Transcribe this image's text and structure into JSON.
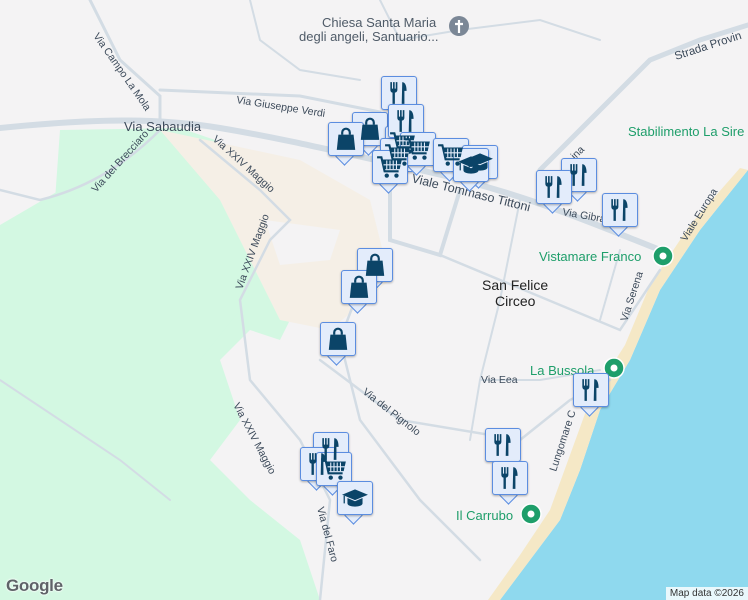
{
  "map": {
    "place_label": [
      "San Felice",
      "Circeo"
    ],
    "church_label": [
      "Chiesa Santa Maria",
      "degli angeli, Santuario..."
    ],
    "streets": {
      "sabaudia": "Via Sabaudia",
      "sabaudia2": "Via Sabaudia",
      "verdi": "Via Giuseppe Verdi",
      "campo": "Via Campo La Mola",
      "brecciaro": "Via del Brecciaro",
      "xxiv1": "Via XXIV Maggio",
      "xxiv2": "Via XXIV Maggio",
      "xxiv3": "Via XXIV Maggio",
      "tittoni": "Viale Tommaso Tittoni",
      "gibral": "Via Gibral",
      "strada": "Strada Provin",
      "europa": "Viale Europa",
      "serena": "Via Serena",
      "eea": "Via Eea",
      "pignolo": "Via del Pignolo",
      "lungomare": "Lungomare C",
      "faro": "Via del Faro",
      "ina": "ina"
    },
    "pois": {
      "sirene": "Stabilimento La Sire",
      "vistamare": "Vistamare Franco",
      "bussola": "La Bussola",
      "carrubo": "Il Carrubo"
    },
    "colors": {
      "land": "#f4f3f4",
      "park": "#d3f8e2",
      "sand": "#f5efe6",
      "water": "#8fd9ee",
      "beach": "#f5e8c6",
      "road": "#d3dce4",
      "poi": "#1e9e6a",
      "marker_bg": "#e3ecfb",
      "marker_border": "#5b8de0",
      "marker_icon": "#0b4468"
    },
    "marker_types": {
      "restaurant": "fork-knife-icon",
      "shop": "shopping-bag-icon",
      "grocery": "shopping-cart-icon",
      "school": "graduation-cap-icon"
    }
  },
  "footer": {
    "logo": "Google",
    "credit": "Map data ©2026"
  }
}
